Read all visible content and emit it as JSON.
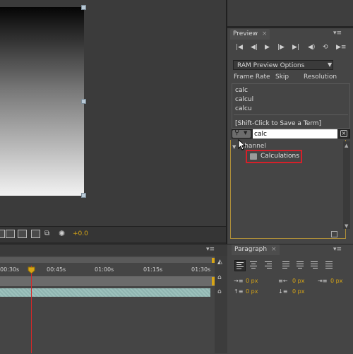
{
  "exposure": {
    "value": "+0.0"
  },
  "preview": {
    "tab_label": "Preview",
    "ram_options_label": "RAM Preview Options",
    "columns": [
      "Frame Rate",
      "Skip",
      "Resolution"
    ]
  },
  "search_history": {
    "items": [
      "calc",
      "calcul",
      "calcu"
    ],
    "hint": "[Shift-Click to Save a Term]"
  },
  "search": {
    "value": "calc"
  },
  "effects": {
    "category": "Channel",
    "result": "Calculations"
  },
  "timeline": {
    "ticks": [
      "00:30s",
      "00:45s",
      "01:00s",
      "01:15s",
      "01:30s"
    ]
  },
  "paragraph": {
    "tab_label": "Paragraph",
    "indent_left": "0 px",
    "indent_first": "0 px",
    "indent_right": "0 px",
    "space_before": "0 px",
    "space_after": "0 px",
    "unit": "px",
    "zero": "0"
  },
  "colors": {
    "accent": "#d7a516",
    "highlight_border": "#d6202a",
    "cti": "#d82828"
  }
}
